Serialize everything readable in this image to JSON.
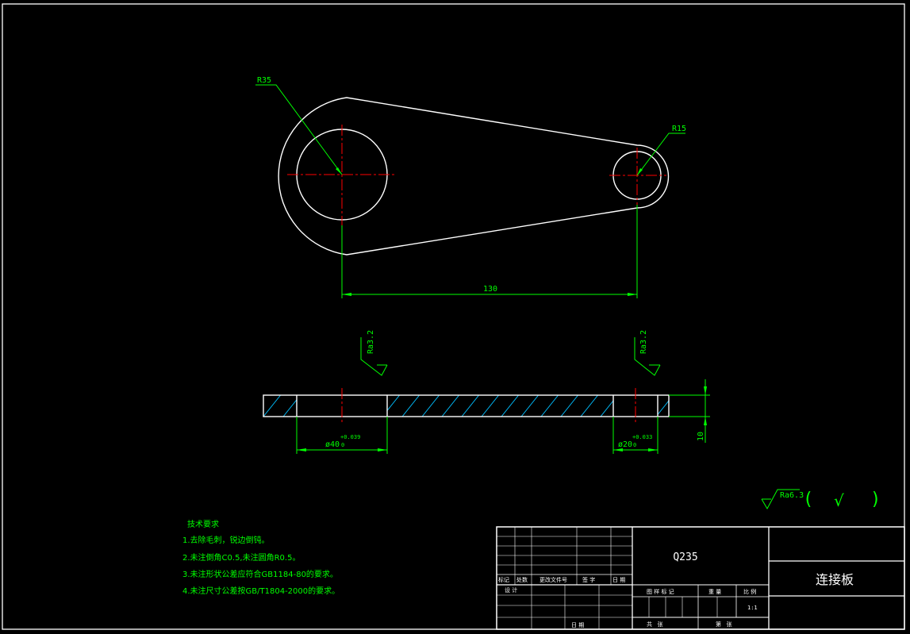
{
  "drawing": {
    "part_name": "连接板",
    "material": "Q235",
    "scale": "1:1"
  },
  "dimensions": {
    "radius_large": "R35",
    "radius_small": "R15",
    "center_distance": "130",
    "thickness": "10",
    "hole_large_dia": "ø40",
    "hole_large_tol_upper": "+0.039",
    "hole_large_tol_lower": "0",
    "hole_small_dia": "ø20",
    "hole_small_tol_upper": "+0.033",
    "hole_small_tol_lower": "0"
  },
  "roughness": {
    "left": "Ra3.2",
    "right": "Ra3.2",
    "general": "Ra6.3",
    "general_open_paren": "(",
    "general_check": "√",
    "general_close_paren": ")"
  },
  "technical_requirements": {
    "title": "技术要求",
    "items": [
      "1.去除毛刺，锐边倒钝。",
      "2.未注倒角C0.5,未注圆角R0.5。",
      "3.未注形状公差应符合GB1184-80的要求。",
      "4.未注尺寸公差按GB/T1804-2000的要求。"
    ]
  },
  "title_block": {
    "revision_labels": [
      "标记",
      "处数",
      "更改文件号",
      "签 字",
      "日 期"
    ],
    "design_label": "设 计",
    "date_label": "日 期",
    "stage_label": "图 样 标 记",
    "weight_label": "重 量",
    "scale_label": "比 例",
    "sheets_label": "共   张",
    "sheet_label": "第   张"
  },
  "colors": {
    "background": "#000000",
    "outline": "#ffffff",
    "dimension": "#00ff00",
    "centerline": "#ff0000",
    "hatch": "#00bfff"
  }
}
